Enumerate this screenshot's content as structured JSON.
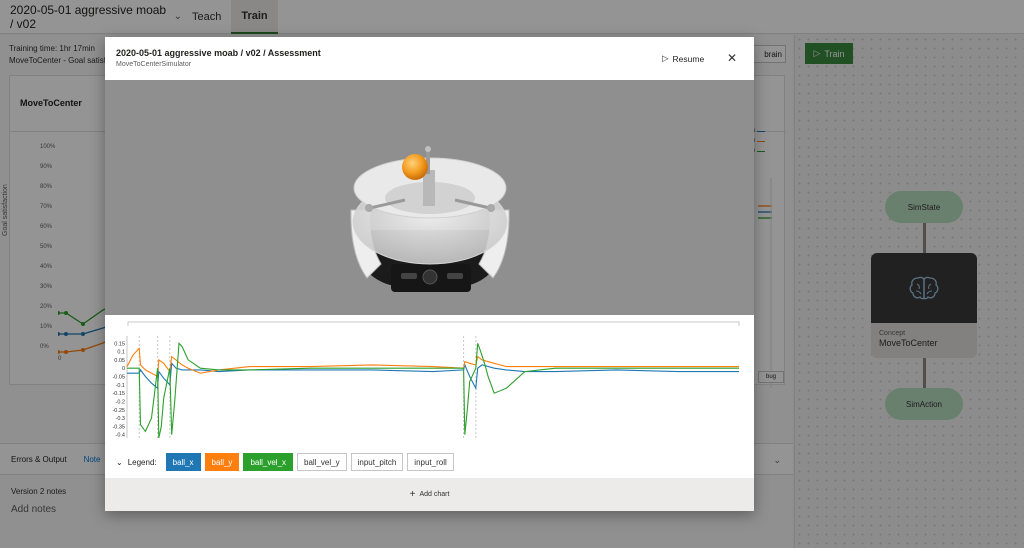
{
  "app": {
    "brain_title": "2020-05-01 aggressive moab / v02",
    "tabs": [
      {
        "label": "Teach"
      },
      {
        "label": "Train"
      }
    ]
  },
  "training": {
    "time_label": "Training time:",
    "time_value": "1hr 17min",
    "goal_line": "MoveToCenter - Goal satisfac"
  },
  "goal_card": {
    "title": "MoveToCenter",
    "y_axis_label": "Goal satisfaction",
    "y_ticks": [
      "100%",
      "90%",
      "80%",
      "70%",
      "60%",
      "50%",
      "40%",
      "30%",
      "20%",
      "10%",
      "0%"
    ],
    "x_first_tick": "0",
    "legend_fragments": [
      "n",
      "n",
      "e"
    ],
    "debug_label": "bug",
    "train_brain_fragment": "brain"
  },
  "bottom": {
    "errors_label": "Errors & Output",
    "notes_tab": "Note",
    "version_notes": "Version 2 notes",
    "add_notes": "Add notes"
  },
  "graph": {
    "train_button": "Train",
    "sim_state": "SimState",
    "concept_kind": "Concept",
    "concept_name": "MoveToCenter",
    "sim_action": "SimAction"
  },
  "modal": {
    "title": "2020-05-01 aggressive moab / v02 / Assessment",
    "subtitle": "MoveToCenterSimulator",
    "resume_label": "Resume",
    "legend_label": "Legend:",
    "add_chart_label": "Add chart",
    "legend_items": [
      {
        "label": "ball_x",
        "active": true,
        "color": "#1f77b4"
      },
      {
        "label": "ball_y",
        "active": true,
        "color": "#ff7f0e"
      },
      {
        "label": "ball_vel_x",
        "active": true,
        "color": "#2ca02c"
      },
      {
        "label": "ball_vel_y",
        "active": false,
        "color": ""
      },
      {
        "label": "input_pitch",
        "active": false,
        "color": ""
      },
      {
        "label": "input_roll",
        "active": false,
        "color": ""
      }
    ]
  },
  "chart_data": {
    "type": "line",
    "y_ticks": [
      "0.15",
      "0.1",
      "0.05",
      "0",
      "-0.05",
      "-0.1",
      "-0.15",
      "-0.2",
      "-0.25",
      "-0.3",
      "-0.35",
      "-0.4"
    ],
    "ylim": [
      -0.42,
      0.17
    ],
    "xlim": [
      0,
      100
    ],
    "episode_resets": [
      2,
      5,
      7,
      55,
      57
    ],
    "series": [
      {
        "name": "ball_x",
        "color": "#1f77b4",
        "x": [
          0,
          2,
          2.2,
          3,
          4,
          5,
          5.2,
          6,
          7,
          7.3,
          8,
          9,
          10,
          12,
          15,
          20,
          30,
          40,
          50,
          55,
          55.2,
          56,
          57,
          57.3,
          58,
          60,
          62,
          65,
          70,
          80,
          90,
          100
        ],
        "y": [
          -0.03,
          -0.03,
          -0.01,
          -0.05,
          -0.09,
          -0.12,
          -0.02,
          -0.06,
          -0.1,
          0.03,
          0.0,
          -0.01,
          -0.01,
          -0.01,
          -0.02,
          -0.01,
          -0.01,
          -0.01,
          -0.02,
          -0.01,
          0.02,
          -0.05,
          -0.12,
          0.0,
          0.02,
          0.0,
          -0.01,
          -0.02,
          -0.02,
          -0.01,
          -0.02,
          -0.02
        ]
      },
      {
        "name": "ball_y",
        "color": "#ff7f0e",
        "x": [
          0,
          1,
          2,
          2.2,
          3,
          4,
          5,
          5.2,
          6,
          7,
          7.3,
          8,
          9,
          10,
          12,
          15,
          20,
          30,
          40,
          50,
          55,
          55.2,
          56,
          57,
          57.3,
          58,
          60,
          62,
          65,
          70,
          80,
          90,
          100
        ],
        "y": [
          0.01,
          0.08,
          0.12,
          0.02,
          -0.01,
          -0.03,
          -0.05,
          0.05,
          0.03,
          -0.02,
          0.07,
          0.05,
          0.02,
          0.0,
          -0.03,
          -0.01,
          0.01,
          0.01,
          0.02,
          0.01,
          0.0,
          0.04,
          0.03,
          0.02,
          0.07,
          0.05,
          0.03,
          0.01,
          0.01,
          0.01,
          0.01,
          0.01,
          0.01
        ]
      },
      {
        "name": "ball_vel_x",
        "color": "#2ca02c",
        "x": [
          0,
          2,
          2.2,
          3,
          4,
          5,
          5.2,
          5.6,
          6,
          7,
          7.3,
          7.8,
          8.5,
          9,
          10,
          12,
          15,
          20,
          30,
          40,
          50,
          55,
          55.2,
          55.6,
          56,
          57,
          57.3,
          57.8,
          58.5,
          59,
          60,
          62,
          65,
          70,
          80,
          90,
          100
        ],
        "y": [
          0.0,
          0.0,
          -0.34,
          -0.38,
          -0.3,
          0.0,
          -0.42,
          -0.35,
          -0.18,
          0.0,
          -0.4,
          -0.2,
          0.15,
          0.13,
          0.05,
          0.0,
          -0.01,
          -0.01,
          0.0,
          0.0,
          0.0,
          0.0,
          -0.4,
          -0.25,
          -0.08,
          0.0,
          0.15,
          0.1,
          0.02,
          -0.05,
          -0.15,
          -0.12,
          -0.02,
          0.0,
          0.0,
          0.0,
          0.0
        ]
      }
    ]
  }
}
